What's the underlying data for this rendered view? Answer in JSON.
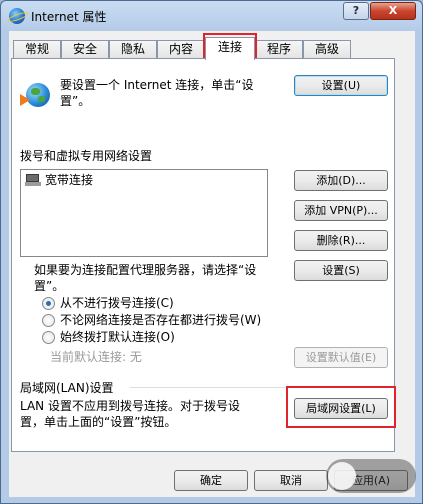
{
  "window": {
    "title": "Internet 属性",
    "help_label": "?",
    "close_label": "X"
  },
  "tabs": [
    {
      "label": "常规",
      "active": false
    },
    {
      "label": "安全",
      "active": false
    },
    {
      "label": "隐私",
      "active": false
    },
    {
      "label": "内容",
      "active": false
    },
    {
      "label": "连接",
      "active": true
    },
    {
      "label": "程序",
      "active": false
    },
    {
      "label": "高级",
      "active": false
    }
  ],
  "connections": {
    "setup_text_line1": "要设置一个 Internet 连接，单击“设",
    "setup_text_line2": "置”。",
    "setup_button": "设置(U)",
    "dialup_section_label": "拨号和虚拟专用网络设置",
    "dialup_list": [
      {
        "label": "宽带连接",
        "icon": "modem-icon"
      }
    ],
    "add_button": "添加(D)...",
    "add_vpn_button": "添加 VPN(P)...",
    "remove_button": "删除(R)...",
    "proxy_text_line1": "如果要为连接配置代理服务器，请选择“设",
    "proxy_text_line2": "置”。",
    "settings_button": "设置(S)",
    "radio_options": [
      {
        "label": "从不进行拨号连接(C)",
        "checked": true
      },
      {
        "label": "不论网络连接是否存在都进行拨号(W)",
        "checked": false
      },
      {
        "label": "始终拨打默认连接(O)",
        "checked": false
      }
    ],
    "current_default_label": "当前默认连接: 无",
    "set_default_button": "设置默认值(E)",
    "lan_section_label": "局域网(LAN)设置",
    "lan_text_line1": "LAN 设置不应用到拨号连接。对于拨号设",
    "lan_text_line2": "置，单击上面的“设置”按钮。",
    "lan_settings_button": "局域网设置(L)"
  },
  "footer": {
    "ok_button": "确定",
    "cancel_button": "取消",
    "apply_button": "应用(A)"
  },
  "colors": {
    "highlight_box": "#e0242b",
    "title_gradient": "#b4cbe8",
    "close_button": "#c9452d"
  }
}
